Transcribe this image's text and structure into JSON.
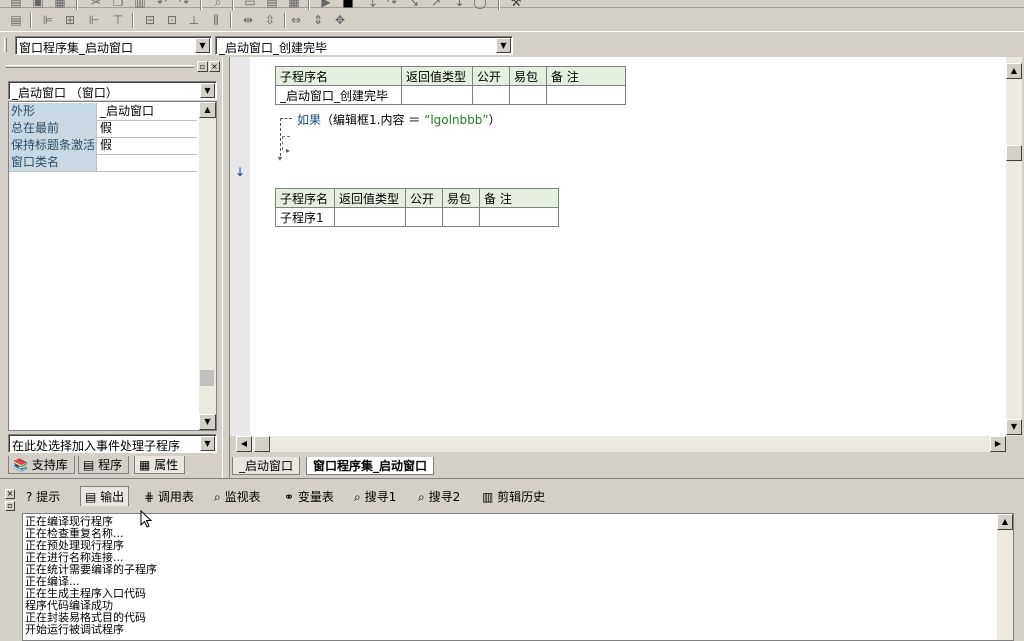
{
  "toolbar": {
    "set_combo": "窗口程序集_启动窗口",
    "method_combo": "_启动窗口_创建完毕"
  },
  "left_panel": {
    "object_combo": "_启动窗口 （窗口）",
    "properties": [
      {
        "key": "外形",
        "value": "_启动窗口"
      },
      {
        "key": "总在最前",
        "value": "假"
      },
      {
        "key": "保持标题条激活",
        "value": "假"
      },
      {
        "key": "窗口类名",
        "value": ""
      }
    ],
    "event_combo": "在此处选择加入事件处理子程序",
    "tabs": [
      "支持库",
      "程序",
      "属性"
    ]
  },
  "editor": {
    "table1": {
      "headers": [
        "子程序名",
        "返回值类型",
        "公开",
        "易包",
        "备 注"
      ],
      "row": [
        "_启动窗口_创建完毕",
        "",
        "",
        "",
        ""
      ]
    },
    "code_line": {
      "keyword": "如果",
      "expr": "（编辑框1.内容 ＝ ",
      "string": "“lgolnbbb”",
      "close": "）"
    },
    "table2": {
      "headers": [
        "子程序名",
        "返回值类型",
        "公开",
        "易包",
        "备 注"
      ],
      "row": [
        "子程序1",
        "",
        "",
        "",
        ""
      ]
    },
    "tabs": [
      "_启动窗口",
      "窗口程序集_启动窗口"
    ]
  },
  "output": {
    "tabs": [
      "提示",
      "输出",
      "调用表",
      "监视表",
      "变量表",
      "搜寻1",
      "搜寻2",
      "剪辑历史"
    ],
    "lines": [
      "正在编译现行程序",
      "正在检查重复名称...",
      "正在预处理现行程序",
      "正在进行名称连接...",
      "正在统计需要编译的子程序",
      "正在编译...",
      "正在生成主程序入口代码",
      "程序代码编译成功",
      "正在封装易格式目的代码",
      "开始运行被调试程序"
    ]
  },
  "colors": {
    "face": "#d4d0c8",
    "prop_key_bg": "#c9d9e4",
    "table_header_bg": "#e4efe0",
    "keyword": "#1a4f8a",
    "string": "#2a7a2a"
  }
}
